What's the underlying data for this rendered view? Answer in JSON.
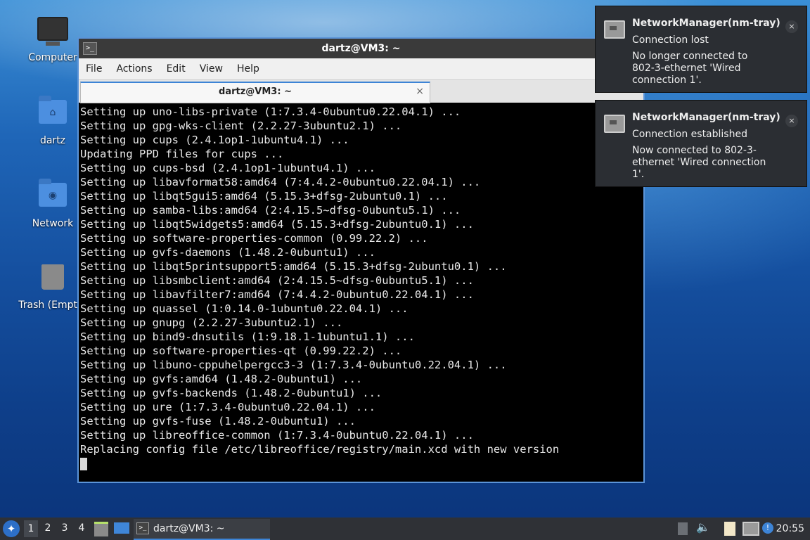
{
  "desktop": {
    "icons": [
      {
        "label": "Computer",
        "icon": "computer-icon"
      },
      {
        "label": "dartz",
        "icon": "home-folder-icon"
      },
      {
        "label": "Network",
        "icon": "network-folder-icon"
      },
      {
        "label": "Trash (Empty)",
        "icon": "trash-icon"
      }
    ]
  },
  "terminal": {
    "title": "dartz@VM3: ~",
    "menu": [
      "File",
      "Actions",
      "Edit",
      "View",
      "Help"
    ],
    "tab_label": "dartz@VM3: ~",
    "tab_close": "×",
    "lines": [
      "Setting up uno-libs-private (1:7.3.4-0ubuntu0.22.04.1) ...",
      "Setting up gpg-wks-client (2.2.27-3ubuntu2.1) ...",
      "Setting up cups (2.4.1op1-1ubuntu4.1) ...",
      "Updating PPD files for cups ...",
      "Setting up cups-bsd (2.4.1op1-1ubuntu4.1) ...",
      "Setting up libavformat58:amd64 (7:4.4.2-0ubuntu0.22.04.1) ...",
      "Setting up libqt5gui5:amd64 (5.15.3+dfsg-2ubuntu0.1) ...",
      "Setting up samba-libs:amd64 (2:4.15.5~dfsg-0ubuntu5.1) ...",
      "Setting up libqt5widgets5:amd64 (5.15.3+dfsg-2ubuntu0.1) ...",
      "Setting up software-properties-common (0.99.22.2) ...",
      "Setting up gvfs-daemons (1.48.2-0ubuntu1) ...",
      "Setting up libqt5printsupport5:amd64 (5.15.3+dfsg-2ubuntu0.1) ...",
      "Setting up libsmbclient:amd64 (2:4.15.5~dfsg-0ubuntu5.1) ...",
      "Setting up libavfilter7:amd64 (7:4.4.2-0ubuntu0.22.04.1) ...",
      "Setting up quassel (1:0.14.0-1ubuntu0.22.04.1) ...",
      "Setting up gnupg (2.2.27-3ubuntu2.1) ...",
      "Setting up bind9-dnsutils (1:9.18.1-1ubuntu1.1) ...",
      "Setting up software-properties-qt (0.99.22.2) ...",
      "Setting up libuno-cppuhelpergcc3-3 (1:7.3.4-0ubuntu0.22.04.1) ...",
      "Setting up gvfs:amd64 (1.48.2-0ubuntu1) ...",
      "Setting up gvfs-backends (1.48.2-0ubuntu1) ...",
      "Setting up ure (1:7.3.4-0ubuntu0.22.04.1) ...",
      "Setting up gvfs-fuse (1.48.2-0ubuntu1) ...",
      "Setting up libreoffice-common (1:7.3.4-0ubuntu0.22.04.1) ...",
      "Replacing config file /etc/libreoffice/registry/main.xcd with new version"
    ]
  },
  "notifications": [
    {
      "app": "NetworkManager(nm-tray)",
      "summary": "Connection lost",
      "body": "No longer connected to 802-3-ethernet 'Wired connection 1'.",
      "close": "×"
    },
    {
      "app": "NetworkManager(nm-tray)",
      "summary": "Connection established",
      "body": "Now connected to 802-3-ethernet 'Wired connection 1'.",
      "close": "×"
    }
  ],
  "taskbar": {
    "workspaces": [
      "1",
      "2",
      "3",
      "4"
    ],
    "active_workspace": "1",
    "task_label": "dartz@VM3: ~",
    "clock": "20:55",
    "tray_icons": [
      "keyboard-layout-icon",
      "volume-icon",
      "clipboard-icon",
      "network-icon",
      "update-notifier-icon"
    ]
  }
}
